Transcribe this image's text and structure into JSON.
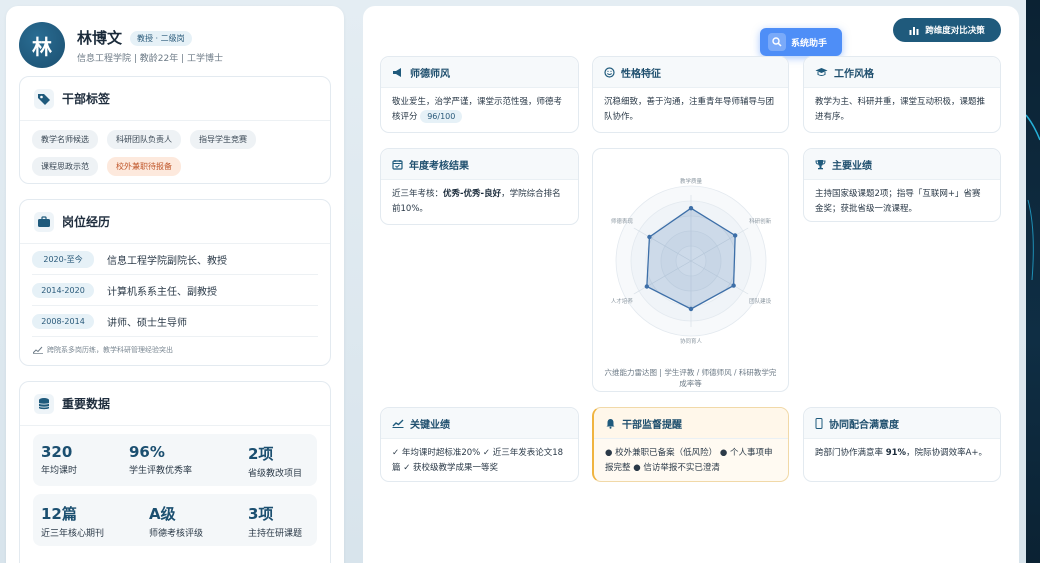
{
  "profile": {
    "avatar_char": "林",
    "name": "林博文",
    "role_badge": "教授 · 二级岗",
    "info": "信息工程学院 | 教龄22年 | 工学博士"
  },
  "tags_card": {
    "title": "干部标签",
    "tags": [
      "教学名师候选",
      "科研团队负责人",
      "指导学生竞赛",
      "课程思政示范",
      "校外兼职待报备"
    ]
  },
  "jobs_card": {
    "title": "岗位经历",
    "items": [
      {
        "years": "2020-至今",
        "title": "信息工程学院副院长、教授"
      },
      {
        "years": "2014-2020",
        "title": "计算机系系主任、副教授"
      },
      {
        "years": "2008-2014",
        "title": "讲师、硕士生导师"
      }
    ],
    "note": "跨院系多岗历练，教学科研管理经验突出"
  },
  "stats_card": {
    "title": "重要数据",
    "stats": [
      {
        "value": "320",
        "label": "年均课时"
      },
      {
        "value": "96%",
        "label": "学生评教优秀率"
      },
      {
        "value": "2项",
        "label": "省级教改项目"
      },
      {
        "value": "12篇",
        "label": "近三年核心期刊"
      },
      {
        "value": "A级",
        "label": "师德考核评级"
      },
      {
        "value": "3项",
        "label": "主持在研课题"
      }
    ]
  },
  "header": {
    "compare_button": "跨维度对比决策",
    "assistant_button": "系统助手"
  },
  "cards": {
    "ethics": {
      "title": "师德师风",
      "text": "敬业爱生，治学严谨，课堂示范性强，师德考核评分",
      "score": "96/100"
    },
    "personality": {
      "title": "性格特征",
      "text": "沉稳细致，善于沟通，注重青年导师辅导与团队协作。"
    },
    "workstyle": {
      "title": "工作风格",
      "text": "教学为主、科研并重，课堂互动积极，课题推进有序。"
    },
    "annual": {
      "title": "年度考核结果",
      "text_pre": "近三年考核：",
      "text_bold": "优秀-优秀-良好",
      "text_post": "，学院综合排名前10%。"
    },
    "achievements": {
      "title": "主要业绩",
      "text": "主持国家级课题2项；指导「互联网+」省赛金奖；获批省级一流课程。"
    },
    "key": {
      "title": "关键业绩",
      "text": "✓ 年均课时超标准20% ✓ 近三年发表论文18篇 ✓ 获校级教学成果一等奖"
    },
    "supervision": {
      "title": "干部监督提醒",
      "text": "● 校外兼职已备案（低风险） ● 个人事项申报完整 ● 信访举报不实已澄清"
    },
    "satisfaction": {
      "title": "协同配合满意度",
      "text_pre": "跨部门协作满意率 ",
      "text_bold": "91%",
      "text_post": "，院际协调效率A+。"
    }
  },
  "chart_data": {
    "type": "radar",
    "axes": [
      "教学质量",
      "科研创新",
      "团队建设",
      "协同育人",
      "人才培养",
      "师德表现"
    ],
    "values": [
      0.88,
      0.85,
      0.82,
      0.8,
      0.85,
      0.8
    ],
    "caption": "六维能力雷达图 | 学生评教 / 师德师风 / 科研教学完成率等",
    "color": "#3d6fa8"
  },
  "colors": {
    "primary": "#1f5a7c",
    "accent": "#4e8ef7",
    "warn": "#c0562a"
  }
}
